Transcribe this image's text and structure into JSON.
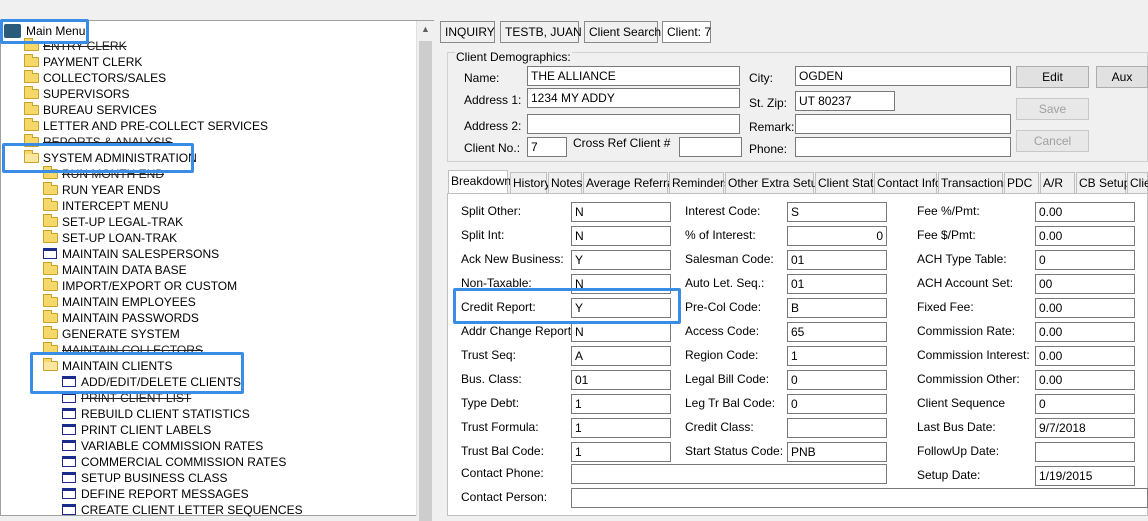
{
  "tree": {
    "root": "Main Menu",
    "items": [
      {
        "label": "ENTRY CLERK",
        "icon": "folder-icon",
        "strike": true
      },
      {
        "label": "PAYMENT CLERK",
        "icon": "folder-icon"
      },
      {
        "label": "COLLECTORS/SALES",
        "icon": "folder-icon"
      },
      {
        "label": "SUPERVISORS",
        "icon": "folder-icon"
      },
      {
        "label": "BUREAU SERVICES",
        "icon": "folder-icon"
      },
      {
        "label": "LETTER AND PRE-COLLECT SERVICES",
        "icon": "folder-icon"
      },
      {
        "label": "REPORTS & ANALYSIS",
        "icon": "folder-icon",
        "strike": true
      },
      {
        "label": "SYSTEM ADMINISTRATION",
        "icon": "folder-open-icon"
      },
      {
        "label": "RUN MONTH END",
        "icon": "folder-icon",
        "strike": true
      },
      {
        "label": "RUN YEAR ENDS",
        "icon": "folder-icon"
      },
      {
        "label": "INTERCEPT MENU",
        "icon": "folder-icon"
      },
      {
        "label": "SET-UP LEGAL-TRAK",
        "icon": "folder-icon"
      },
      {
        "label": "SET-UP LOAN-TRAK",
        "icon": "folder-icon"
      },
      {
        "label": "MAINTAIN SALESPERSONS",
        "icon": "document-icon"
      },
      {
        "label": "MAINTAIN DATA BASE",
        "icon": "folder-icon"
      },
      {
        "label": "IMPORT/EXPORT OR CUSTOM",
        "icon": "folder-icon"
      },
      {
        "label": "MAINTAIN EMPLOYEES",
        "icon": "folder-icon"
      },
      {
        "label": "MAINTAIN PASSWORDS",
        "icon": "folder-icon"
      },
      {
        "label": "GENERATE SYSTEM",
        "icon": "folder-icon"
      },
      {
        "label": "MAINTAIN COLLECTORS",
        "icon": "folder-icon",
        "strike": true
      },
      {
        "label": "MAINTAIN CLIENTS",
        "icon": "folder-open-icon"
      },
      {
        "label": "ADD/EDIT/DELETE CLIENTS",
        "icon": "document-icon"
      },
      {
        "label": "PRINT CLIENT LIST",
        "icon": "document-icon",
        "strike": true
      },
      {
        "label": "REBUILD CLIENT STATISTICS",
        "icon": "document-icon"
      },
      {
        "label": "PRINT CLIENT LABELS",
        "icon": "document-icon"
      },
      {
        "label": "VARIABLE COMMISSION RATES",
        "icon": "document-icon"
      },
      {
        "label": "COMMERCIAL COMMISSION RATES",
        "icon": "document-icon"
      },
      {
        "label": "SETUP BUSINESS CLASS",
        "icon": "document-icon"
      },
      {
        "label": "DEFINE REPORT MESSAGES",
        "icon": "document-icon"
      },
      {
        "label": "CREATE CLIENT LETTER SEQUENCES",
        "icon": "document-icon"
      }
    ]
  },
  "top_tabs": [
    "INQUIRY",
    "TESTB, JUAN",
    "Client Search",
    "Client: 7"
  ],
  "demographics": {
    "group_title": "Client Demographics:",
    "name_label": "Name:",
    "name_value": "THE ALLIANCE",
    "addr1_label": "Address 1:",
    "addr1_value": "1234 MY ADDY",
    "addr2_label": "Address 2:",
    "addr2_value": "",
    "clientno_label": "Client No.:",
    "clientno_value": "7",
    "crossref_label": "Cross Ref Client #",
    "crossref_value": "",
    "city_label": "City:",
    "city_value": "OGDEN",
    "stzip_label": "St. Zip:",
    "stzip_value": "UT 80237",
    "remark_label": "Remark:",
    "remark_value": "",
    "phone_label": "Phone:",
    "phone_value": "",
    "edit_button": "Edit",
    "aux_button": "Aux",
    "save_button": "Save",
    "cancel_button": "Cancel"
  },
  "subtabs": [
    "Breakdown",
    "History",
    "Notes",
    "Average Referral",
    "Reminders",
    "Other Extra Setup",
    "Client Stats",
    "Contact Info",
    "Transactions",
    "PDC",
    "A/R",
    "CB Setup",
    "Clie"
  ],
  "breakdown": {
    "col1": [
      {
        "label": "Split Other:",
        "value": "N"
      },
      {
        "label": "Split Int:",
        "value": "N"
      },
      {
        "label": "Ack New Business:",
        "value": "Y"
      },
      {
        "label": "Non-Taxable:",
        "value": "N"
      },
      {
        "label": "Credit Report:",
        "value": "Y"
      },
      {
        "label": "Addr Change Report:",
        "value": "N"
      },
      {
        "label": "Trust Seq:",
        "value": "A"
      },
      {
        "label": "Bus. Class:",
        "value": "01"
      },
      {
        "label": "Type Debt:",
        "value": "1"
      },
      {
        "label": "Trust Formula:",
        "value": "1"
      },
      {
        "label": "Trust Bal Code:",
        "value": "1"
      }
    ],
    "col2": [
      {
        "label": "Interest Code:",
        "value": "S"
      },
      {
        "label": "% of Interest:",
        "value": "0"
      },
      {
        "label": "Salesman Code:",
        "value": "01"
      },
      {
        "label": "Auto Let. Seq.:",
        "value": "01"
      },
      {
        "label": "Pre-Col Code:",
        "value": "B"
      },
      {
        "label": "Access Code:",
        "value": "65"
      },
      {
        "label": "Region Code:",
        "value": "1"
      },
      {
        "label": "Legal Bill Code:",
        "value": "0"
      },
      {
        "label": "Leg Tr Bal Code:",
        "value": "0"
      },
      {
        "label": "Credit Class:",
        "value": ""
      },
      {
        "label": "Start Status Code:",
        "value": "PNB"
      }
    ],
    "col3": [
      {
        "label": "Fee %/Pmt:",
        "value": "0.00"
      },
      {
        "label": "Fee $/Pmt:",
        "value": "0.00"
      },
      {
        "label": "ACH Type Table:",
        "value": "0"
      },
      {
        "label": "ACH Account Set:",
        "value": "00"
      },
      {
        "label": "Fixed Fee:",
        "value": "0.00"
      },
      {
        "label": "Commission Rate:",
        "value": "0.00"
      },
      {
        "label": "Commission Interest:",
        "value": "0.00"
      },
      {
        "label": "Commission Other:",
        "value": "0.00"
      },
      {
        "label": "Client Sequence",
        "value": "0"
      },
      {
        "label": "Last Bus Date:",
        "value": "9/7/2018"
      },
      {
        "label": "FollowUp Date:",
        "value": ""
      },
      {
        "label": "Setup Date:",
        "value": "1/19/2015"
      }
    ],
    "contact_phone_label": "Contact Phone:",
    "contact_phone_value": "",
    "contact_person_label": "Contact Person:",
    "contact_person_value": ""
  }
}
